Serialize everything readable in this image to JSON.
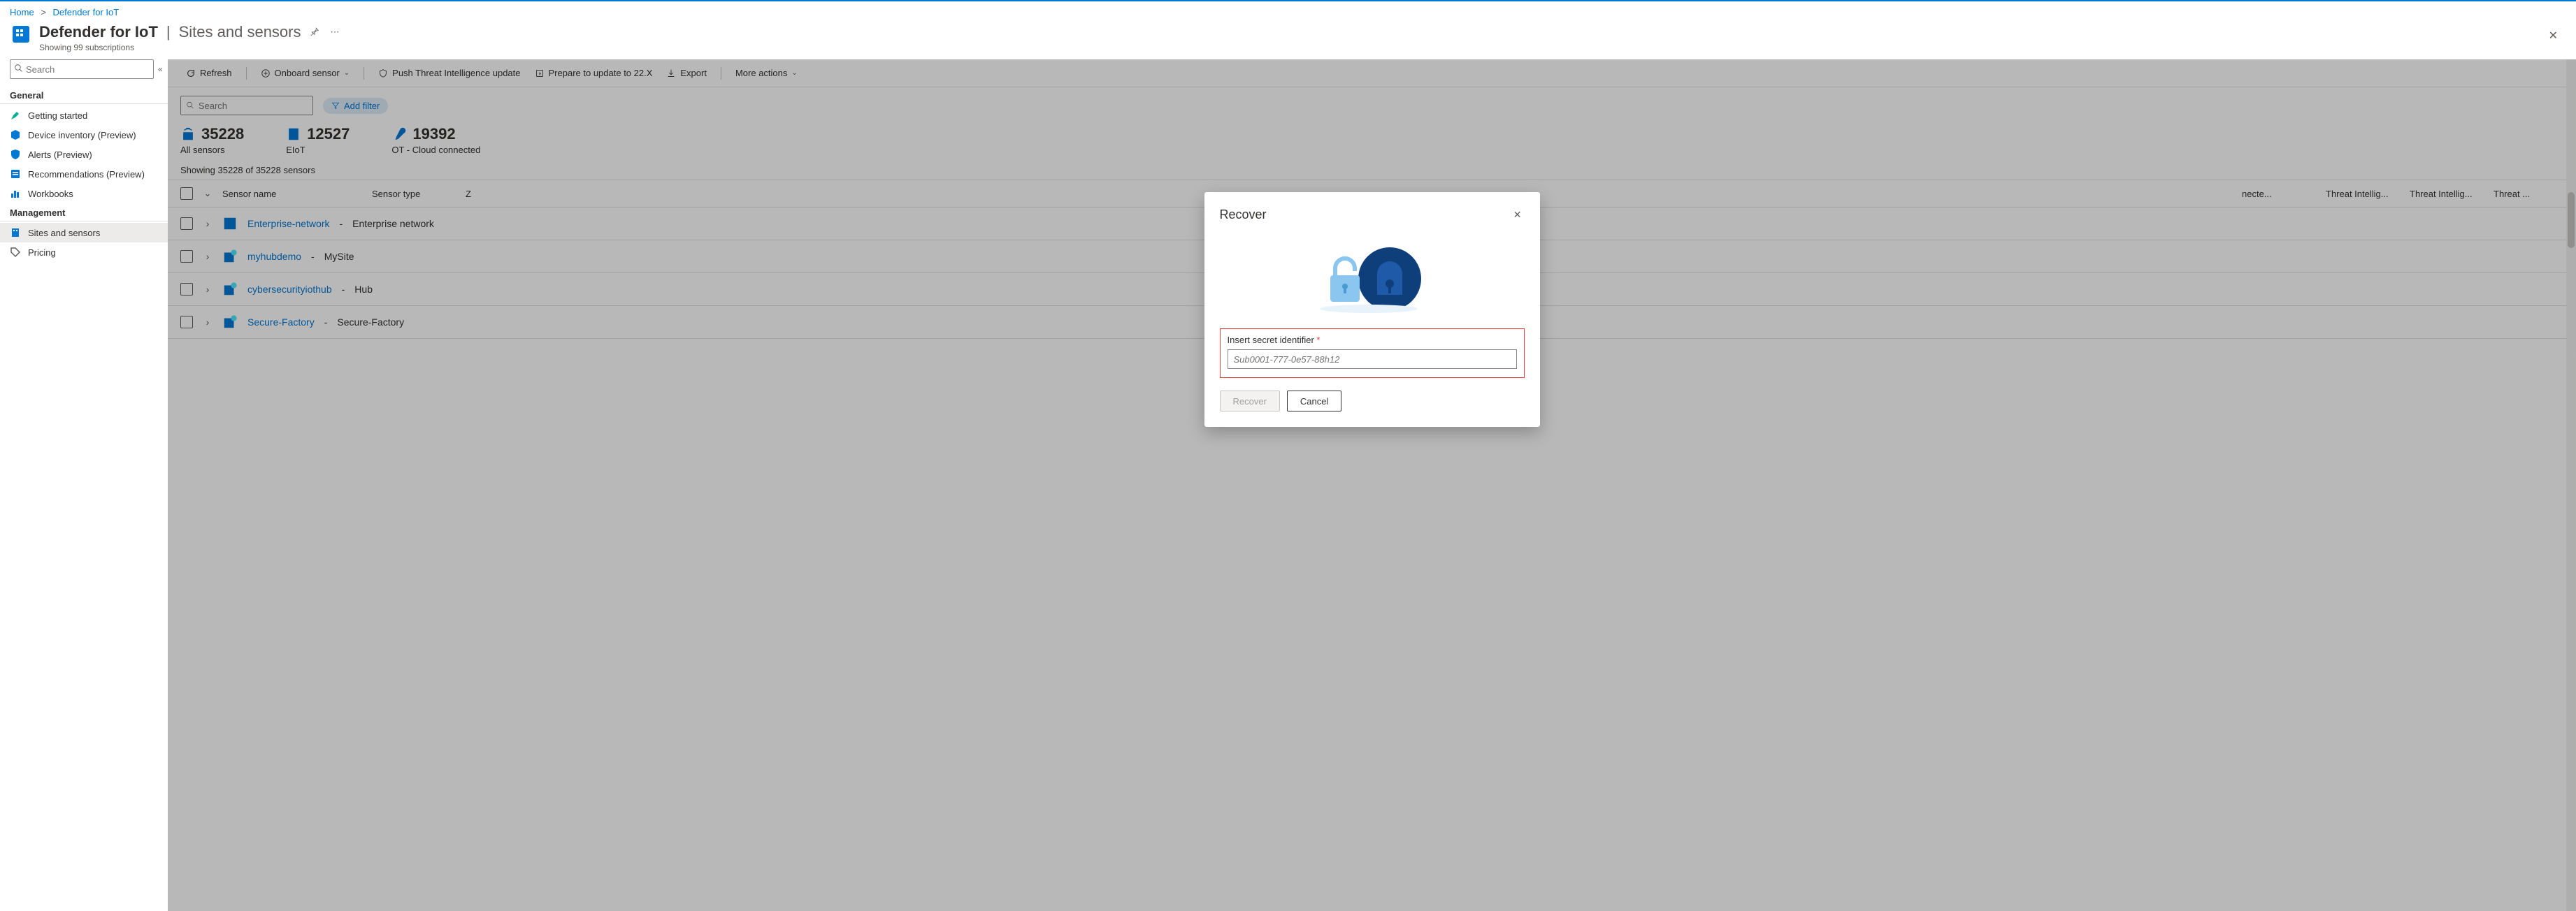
{
  "breadcrumb": {
    "home": "Home",
    "current": "Defender for IoT"
  },
  "header": {
    "title_main": "Defender for IoT",
    "title_sub": "Sites and sensors",
    "subtitle": "Showing 99 subscriptions"
  },
  "sidebar": {
    "search_placeholder": "Search",
    "groups": [
      {
        "label": "General",
        "items": [
          {
            "label": "Getting started",
            "icon": "rocket",
            "color": "#00b294"
          },
          {
            "label": "Device inventory (Preview)",
            "icon": "cube",
            "color": "#0078d4"
          },
          {
            "label": "Alerts (Preview)",
            "icon": "shield",
            "color": "#0078d4"
          },
          {
            "label": "Recommendations (Preview)",
            "icon": "list",
            "color": "#0078d4"
          },
          {
            "label": "Workbooks",
            "icon": "chart",
            "color": "#0078d4"
          }
        ]
      },
      {
        "label": "Management",
        "items": [
          {
            "label": "Sites and sensors",
            "icon": "building",
            "color": "#0078d4",
            "selected": true
          },
          {
            "label": "Pricing",
            "icon": "tag",
            "color": "#605e5c"
          }
        ]
      }
    ]
  },
  "toolbar": {
    "refresh": "Refresh",
    "onboard": "Onboard sensor",
    "push_ti": "Push Threat Intelligence update",
    "prepare": "Prepare to update to 22.X",
    "export": "Export",
    "more": "More actions"
  },
  "filter": {
    "search_placeholder": "Search",
    "add_filter": "Add filter"
  },
  "stats": [
    {
      "value": "35228",
      "label": "All sensors"
    },
    {
      "value": "12527",
      "label": "EIoT"
    },
    {
      "value": "19392",
      "label": "OT - Cloud connected"
    }
  ],
  "showing_text": "Showing 35228 of 35228 sensors",
  "columns": {
    "name": "Sensor name",
    "type": "Sensor type",
    "z": "Z",
    "c1": "necte...",
    "c2": "Threat Intellig...",
    "c3": "Threat Intellig...",
    "c4": "Threat ..."
  },
  "rows": [
    {
      "link": "Enterprise-network",
      "desc": "Enterprise network"
    },
    {
      "link": "myhubdemo",
      "desc": "MySite"
    },
    {
      "link": "cybersecurityiothub",
      "desc": "Hub"
    },
    {
      "link": "Secure-Factory",
      "desc": "Secure-Factory"
    }
  ],
  "modal": {
    "title": "Recover",
    "field_label": "Insert secret identifier",
    "placeholder": "Sub0001-777-0e57-88h12",
    "recover_btn": "Recover",
    "cancel_btn": "Cancel"
  }
}
